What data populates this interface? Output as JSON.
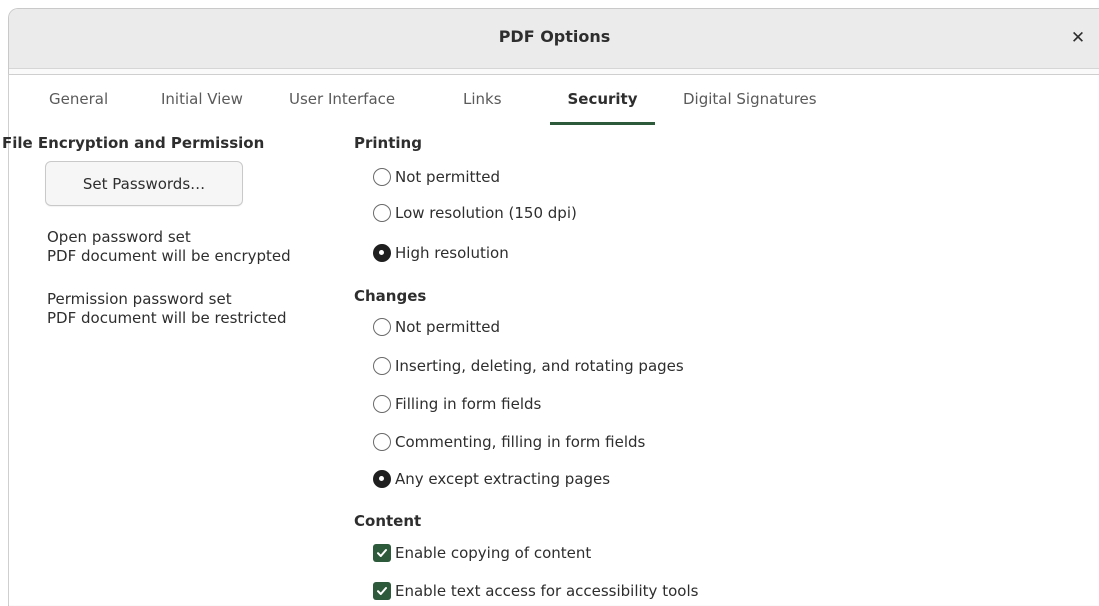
{
  "window": {
    "title": "PDF Options",
    "close_icon": "close-icon"
  },
  "tabs": [
    {
      "label": "General",
      "active": false
    },
    {
      "label": "Initial View",
      "active": false
    },
    {
      "label": "User Interface",
      "active": false
    },
    {
      "label": "Links",
      "active": false
    },
    {
      "label": "Security",
      "active": true
    },
    {
      "label": "Digital Signatures",
      "active": false
    }
  ],
  "encryption": {
    "heading": "File Encryption and Permission",
    "set_passwords_label": "Set Passwords…",
    "open_line1": "Open password set",
    "open_line2": "PDF document will be encrypted",
    "perm_line1": "Permission password set",
    "perm_line2": "PDF document will be restricted"
  },
  "printing": {
    "heading": "Printing",
    "options": [
      {
        "label": "Not permitted",
        "selected": false
      },
      {
        "label": "Low resolution (150 dpi)",
        "selected": false
      },
      {
        "label": "High resolution",
        "selected": true
      }
    ]
  },
  "changes": {
    "heading": "Changes",
    "options": [
      {
        "label": "Not permitted",
        "selected": false
      },
      {
        "label": "Inserting, deleting, and rotating pages",
        "selected": false
      },
      {
        "label": "Filling in form fields",
        "selected": false
      },
      {
        "label": "Commenting, filling in form fields",
        "selected": false
      },
      {
        "label": "Any except extracting pages",
        "selected": true
      }
    ]
  },
  "content": {
    "heading": "Content",
    "options": [
      {
        "label": "Enable copying of content",
        "checked": true
      },
      {
        "label": "Enable text access for accessibility tools",
        "checked": true
      }
    ]
  },
  "colors": {
    "accent": "#2d5a3a",
    "radio_selected": "#1f1f1f"
  }
}
